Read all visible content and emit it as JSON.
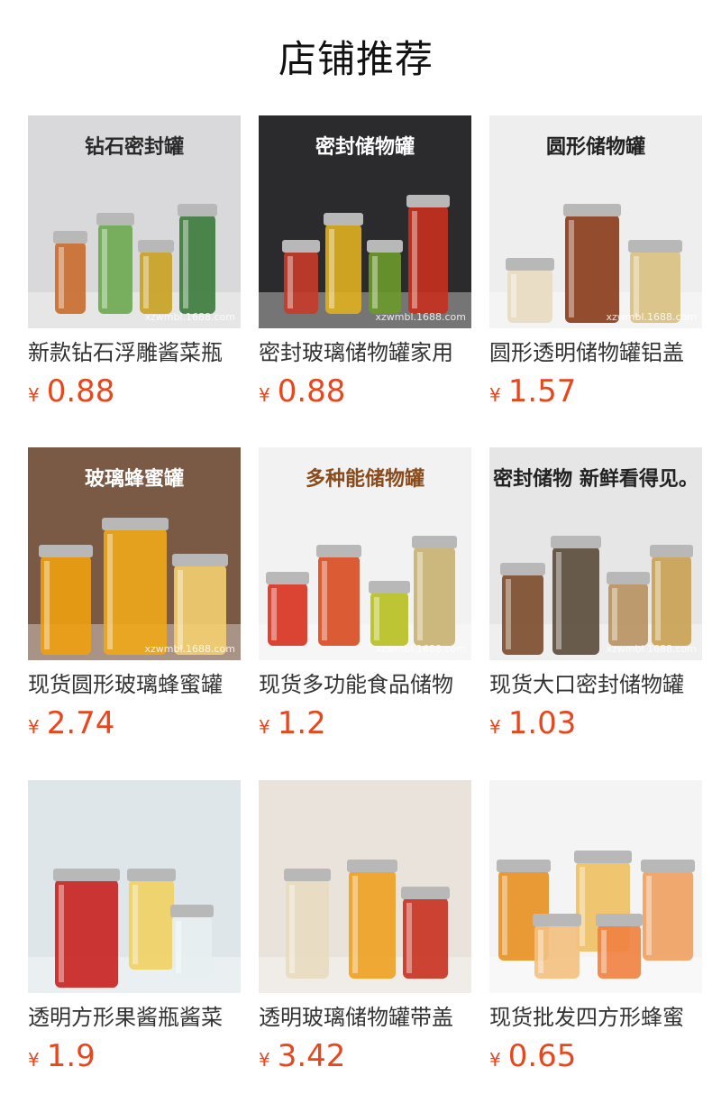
{
  "header": {
    "title": "店铺推荐"
  },
  "products": [
    {
      "name": "新款钻石浮雕酱菜瓶",
      "currency": "¥",
      "price": "0.88",
      "banner": "钻石密封罐",
      "watermark": "xzwmbl.1688.com",
      "bg": "#d9d9db",
      "accent": "#2a2a2a",
      "icon": "glass-jar-image"
    },
    {
      "name": "密封玻璃储物罐家用",
      "currency": "¥",
      "price": "0.88",
      "banner": "密封储物罐",
      "watermark": "xzwmbl.1688.com",
      "bg": "#2b2b2d",
      "accent": "#ffffff",
      "icon": "glass-jar-image"
    },
    {
      "name": "圆形透明储物罐铝盖",
      "currency": "¥",
      "price": "1.57",
      "banner": "圆形储物罐",
      "watermark": "xzwmbl.1688.com",
      "bg": "#eeeeee",
      "accent": "#222222",
      "icon": "glass-jar-image"
    },
    {
      "name": "现货圆形玻璃蜂蜜罐",
      "currency": "¥",
      "price": "2.74",
      "banner": "玻璃蜂蜜罐",
      "watermark": "xzwmbl.1688.com",
      "bg": "#7a5a45",
      "accent": "#ffffff",
      "icon": "honey-jar-image"
    },
    {
      "name": "现货多功能食品储物",
      "currency": "¥",
      "price": "1.2",
      "banner": "多种能储物罐",
      "watermark": "xzwmbl.1688.com",
      "bg": "#f2f2f2",
      "accent": "#8a4a1a",
      "icon": "glass-jar-image"
    },
    {
      "name": "现货大口密封储物罐",
      "currency": "¥",
      "price": "1.03",
      "banner": "密封储物 新鲜看得见。",
      "watermark": "xzwmbl.1688.com",
      "bg": "#e6e6e6",
      "accent": "#222222",
      "icon": "glass-jar-image"
    },
    {
      "name": "透明方形果酱瓶酱菜",
      "currency": "¥",
      "price": "1.9",
      "banner": "",
      "watermark": "",
      "bg": "#dfe6ea",
      "accent": "#c03a2b",
      "icon": "square-jar-image"
    },
    {
      "name": "透明玻璃储物罐带盖",
      "currency": "¥",
      "price": "3.42",
      "banner": "",
      "watermark": "",
      "bg": "#e9e3dc",
      "accent": "#9a6a3a",
      "icon": "glass-jar-image"
    },
    {
      "name": "现货批发四方形蜂蜜",
      "currency": "¥",
      "price": "0.65",
      "banner": "",
      "watermark": "",
      "bg": "#f4f4f4",
      "accent": "#222222",
      "icon": "honey-jar-image"
    }
  ]
}
